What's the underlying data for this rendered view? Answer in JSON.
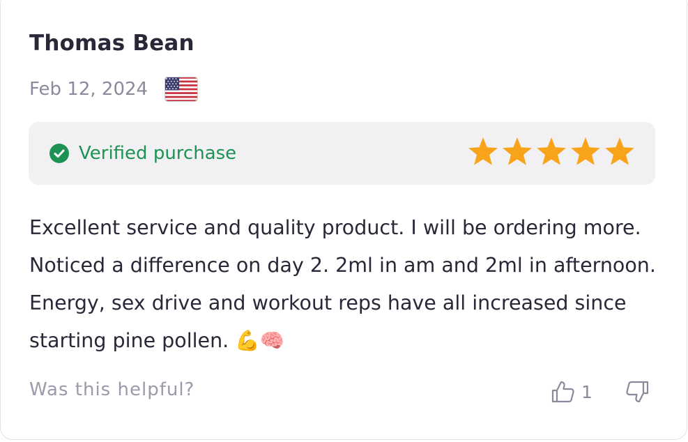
{
  "review": {
    "reviewer_name": "Thomas Bean",
    "date": "Feb 12, 2024",
    "country_flag_icon": "us-flag-icon",
    "verified_label": "Verified purchase",
    "rating": 5,
    "rating_max": 5,
    "star_color": "#f9a31a",
    "verified_color": "#1e9254",
    "text": "Excellent service and quality product. I will be ordering more. Noticed a difference on day 2. 2ml in am and 2ml in afternoon. Energy, sex drive and workout reps have all increased since starting pine pollen. 💪🧠"
  },
  "feedback": {
    "question": "Was this helpful?",
    "helpful_count": "1",
    "thumbs_up_icon": "thumbs-up-icon",
    "thumbs_down_icon": "thumbs-down-icon"
  }
}
